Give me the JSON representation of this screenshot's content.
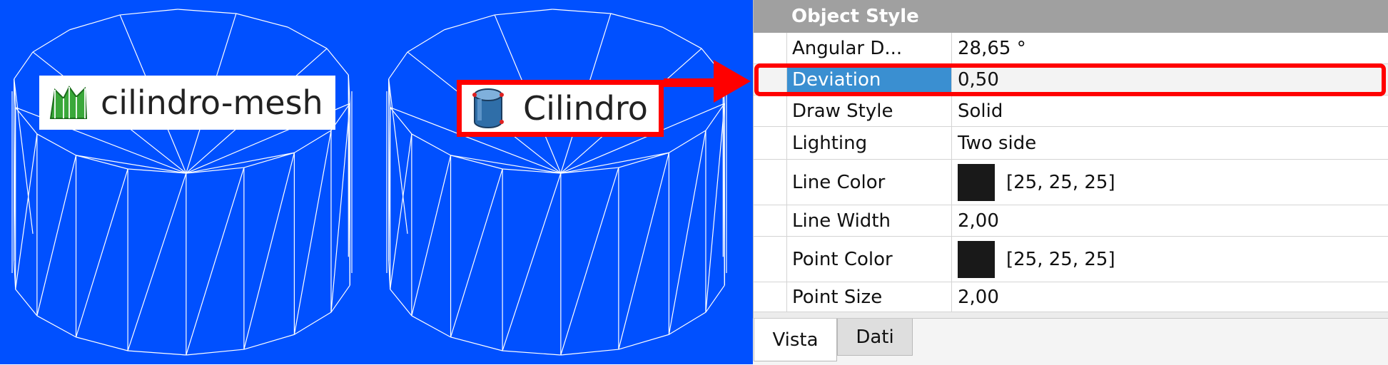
{
  "viewport": {
    "background_color": "#0050ff",
    "objects": [
      {
        "label": "cilindro-mesh",
        "icon": "mesh-icon"
      },
      {
        "label": "Cilindro",
        "icon": "cylinder-icon"
      }
    ]
  },
  "property_panel": {
    "group": "Object Style",
    "rows": [
      {
        "key": "Angular D...",
        "value": "28,65 °"
      },
      {
        "key": "Deviation",
        "value": "0,50",
        "selected": true
      },
      {
        "key": "Draw Style",
        "value": "Solid"
      },
      {
        "key": "Lighting",
        "value": "Two side"
      },
      {
        "key": "Line Color",
        "value": "[25, 25, 25]",
        "swatch": "#191919"
      },
      {
        "key": "Line Width",
        "value": "2,00"
      },
      {
        "key": "Point Color",
        "value": "[25, 25, 25]",
        "swatch": "#191919"
      },
      {
        "key": "Point Size",
        "value": "2,00"
      }
    ],
    "tabs": [
      "Vista",
      "Dati"
    ],
    "active_tab": "Vista"
  },
  "highlight_color": "#ff0000"
}
